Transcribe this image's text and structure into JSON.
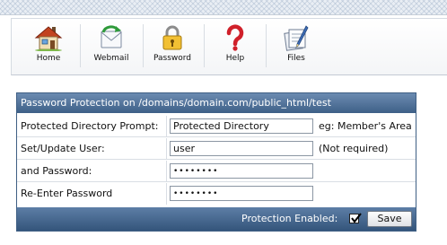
{
  "toolbar": {
    "items": [
      {
        "label": "Home",
        "icon": "home-icon"
      },
      {
        "label": "Webmail",
        "icon": "webmail-icon"
      },
      {
        "label": "Password",
        "icon": "lock-icon"
      },
      {
        "label": "Help",
        "icon": "help-icon"
      },
      {
        "label": "Files",
        "icon": "files-icon"
      }
    ]
  },
  "form": {
    "title": "Password Protection on /domains/domain.com/public_html/test",
    "rows": {
      "prompt": {
        "label": "Protected Directory Prompt:",
        "value": "Protected Directory",
        "hint": "eg: Member's Area"
      },
      "user": {
        "label": "Set/Update User:",
        "value": "user",
        "hint": "(Not required)"
      },
      "password": {
        "label": "and Password:",
        "value": "••••••••"
      },
      "confirm": {
        "label": "Re-Enter Password",
        "value": "••••••••"
      }
    },
    "protection_label": "Protection Enabled:",
    "protection_enabled": true,
    "save_label": "Save"
  },
  "colors": {
    "header_bg": "#4a6c94",
    "footer_bg": "#3e6087",
    "toolbar_bg": "#f4f5f7"
  }
}
